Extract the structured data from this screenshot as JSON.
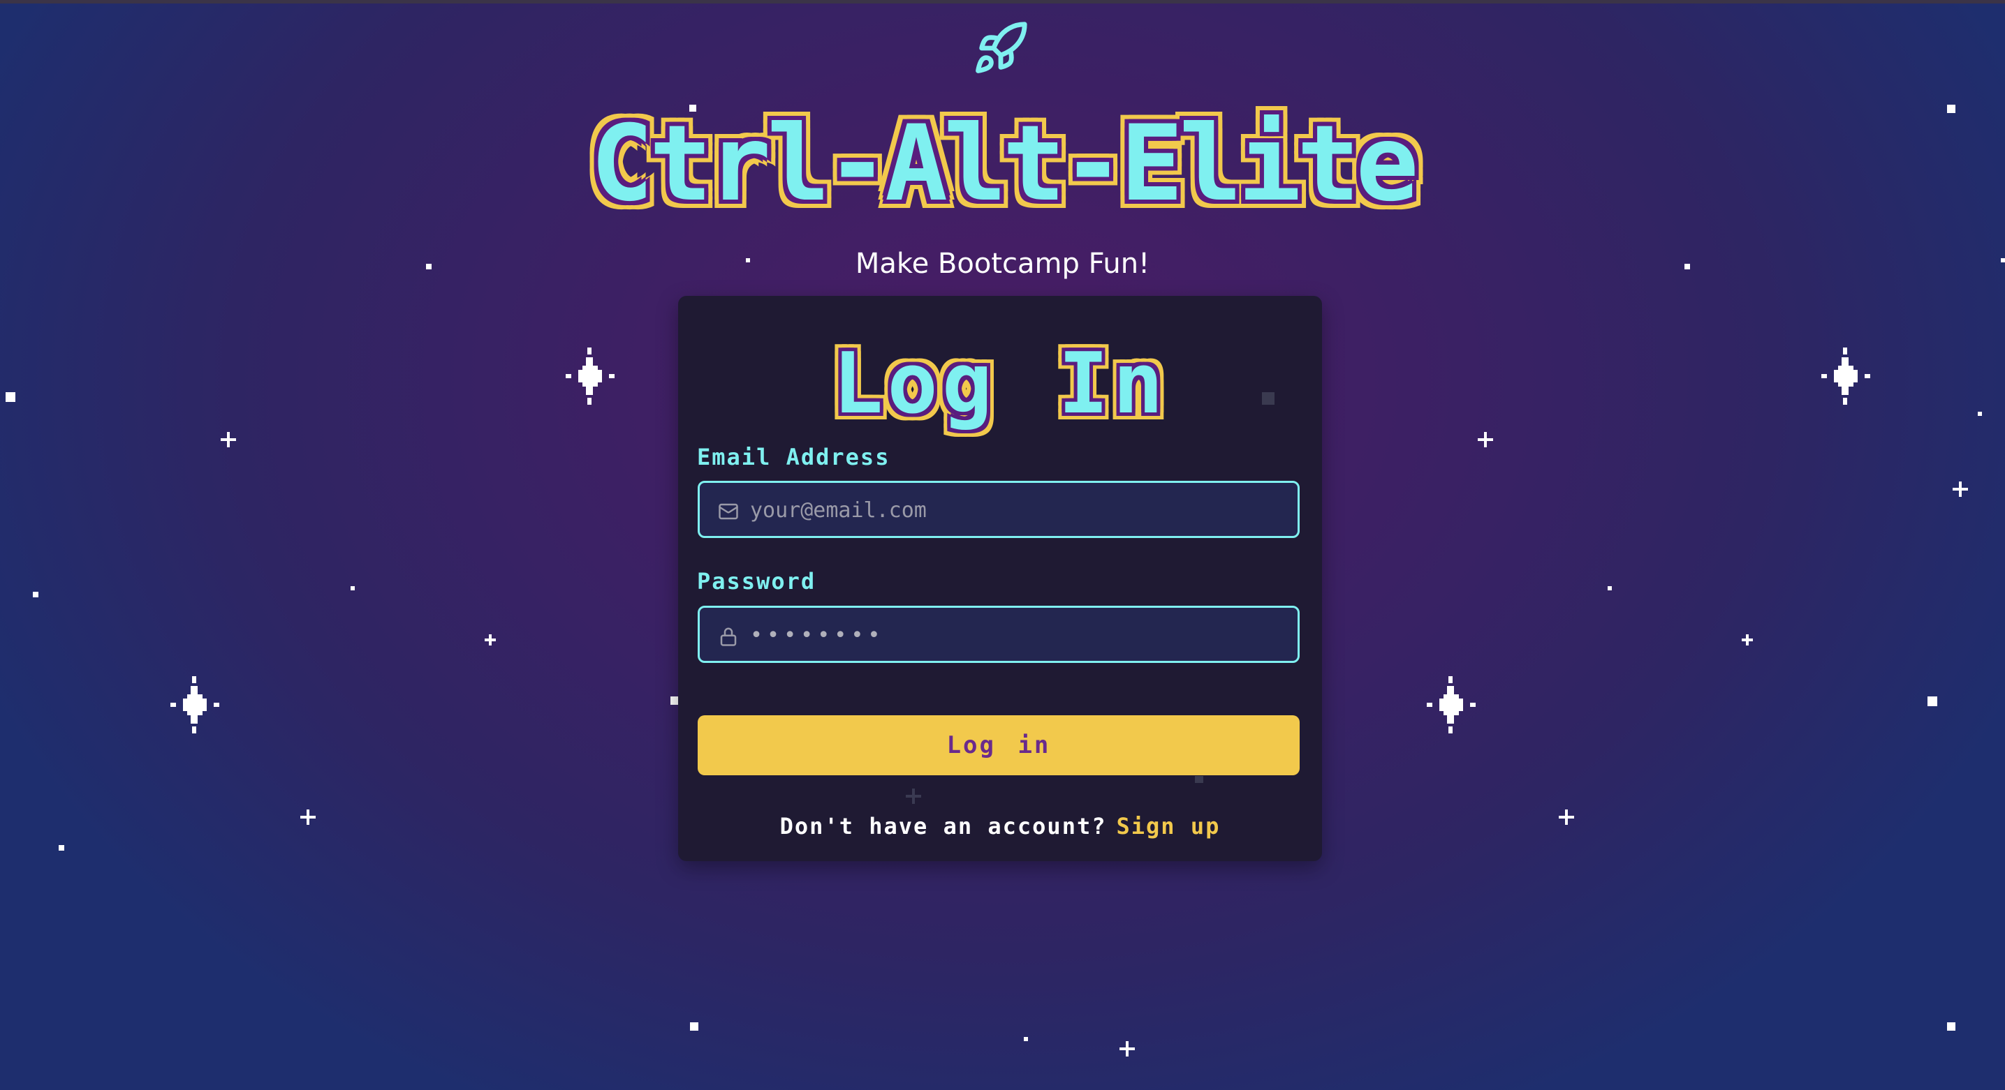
{
  "header": {
    "logo_icon": "rocket-icon",
    "title": "Ctrl-Alt-Elite",
    "tagline": "Make Bootcamp Fun!"
  },
  "login_card": {
    "heading": "Log In",
    "email": {
      "label": "Email Address",
      "placeholder": "your@email.com",
      "icon": "mail-icon"
    },
    "password": {
      "label": "Password",
      "placeholder": "••••••••",
      "icon": "lock-icon"
    },
    "submit_label": "Log in",
    "signup_prompt": "Don't have an account?",
    "signup_link": "Sign up"
  },
  "colors": {
    "accent_cyan": "#7ff0f0",
    "accent_yellow": "#f2c94c",
    "card_bg": "#1f1a33",
    "button_text": "#6a2a8c"
  }
}
